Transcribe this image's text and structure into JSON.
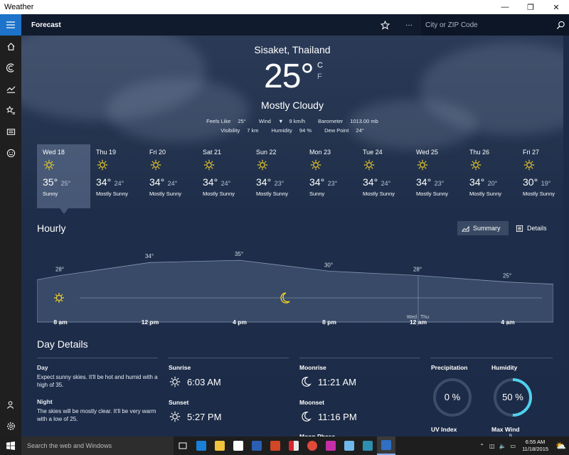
{
  "window": {
    "title": "Weather",
    "minimize": "—",
    "restore": "❐",
    "close": "✕"
  },
  "appbar": {
    "title": "Forecast",
    "search_placeholder": "City or ZIP Code",
    "more": "···"
  },
  "current": {
    "city": "Sisaket, Thailand",
    "temperature": "25°",
    "unit_c": "C",
    "unit_f": "F",
    "condition": "Mostly Cloudy",
    "feels_like_label": "Feels Like",
    "feels_like": "25°",
    "wind_label": "Wind",
    "wind": "9 km/h",
    "barometer_label": "Barometer",
    "barometer": "1013.00 mb",
    "visibility_label": "Visibility",
    "visibility": "7 km",
    "humidity_label": "Humidity",
    "humidity": "94 %",
    "dewpoint_label": "Dew Point",
    "dewpoint": "24°"
  },
  "days": [
    {
      "name": "Wed 18",
      "hi": "35°",
      "lo": "25°",
      "cond": "Sunny"
    },
    {
      "name": "Thu 19",
      "hi": "34°",
      "lo": "24°",
      "cond": "Mostly Sunny"
    },
    {
      "name": "Fri 20",
      "hi": "34°",
      "lo": "24°",
      "cond": "Mostly Sunny"
    },
    {
      "name": "Sat 21",
      "hi": "34°",
      "lo": "24°",
      "cond": "Mostly Sunny"
    },
    {
      "name": "Sun 22",
      "hi": "34°",
      "lo": "23°",
      "cond": "Mostly Sunny"
    },
    {
      "name": "Mon 23",
      "hi": "34°",
      "lo": "23°",
      "cond": "Sunny"
    },
    {
      "name": "Tue 24",
      "hi": "34°",
      "lo": "24°",
      "cond": "Mostly Sunny"
    },
    {
      "name": "Wed 25",
      "hi": "34°",
      "lo": "23°",
      "cond": "Mostly Sunny"
    },
    {
      "name": "Thu 26",
      "hi": "34°",
      "lo": "20°",
      "cond": "Mostly Sunny"
    },
    {
      "name": "Fri 27",
      "hi": "30°",
      "lo": "19°",
      "cond": "Mostly Sunny"
    }
  ],
  "hourly": {
    "title": "Hourly",
    "summary_label": "Summary",
    "details_label": "Details",
    "temps": [
      {
        "label": "28°",
        "value": 28
      },
      {
        "label": "34°",
        "value": 34
      },
      {
        "label": "35°",
        "value": 35
      },
      {
        "label": "30°",
        "value": 30
      },
      {
        "label": "28°",
        "value": 28
      },
      {
        "label": "25°",
        "value": 25
      }
    ],
    "hours": [
      "8 am",
      "12 pm",
      "4 pm",
      "8 pm",
      "12 am",
      "4 am"
    ],
    "day_divider_left": "Wed",
    "day_divider_right": "Thu"
  },
  "day_details": {
    "title": "Day Details",
    "day_label": "Day",
    "day_text": "Expect sunny skies. It'll be hot and humid with a high of 35.",
    "night_label": "Night",
    "night_text": "The skies will be mostly clear. It'll be very warm with a low of 25.",
    "sunrise_label": "Sunrise",
    "sunrise": "6:03 AM",
    "sunset_label": "Sunset",
    "sunset": "5:27 PM",
    "moonrise_label": "Moonrise",
    "moonrise": "11:21 AM",
    "moonset_label": "Moonset",
    "moonset": "11:16 PM",
    "moon_phase_label": "Moon Phase",
    "precip_label": "Precipitation",
    "precip": "0 %",
    "precip_fraction": 0,
    "humidity_label": "Humidity",
    "humidity": "50 %",
    "humidity_fraction": 0.5,
    "uv_label": "UV Index",
    "maxwind_label": "Max Wind",
    "wind_dir": "N"
  },
  "taskbar": {
    "search_placeholder": "Search the web and Windows",
    "time": "6:55 AM",
    "date": "11/18/2015"
  },
  "colors": {
    "accent": "#1c73c9",
    "sun": "#f5d327",
    "ring": "#4fd0ee"
  }
}
